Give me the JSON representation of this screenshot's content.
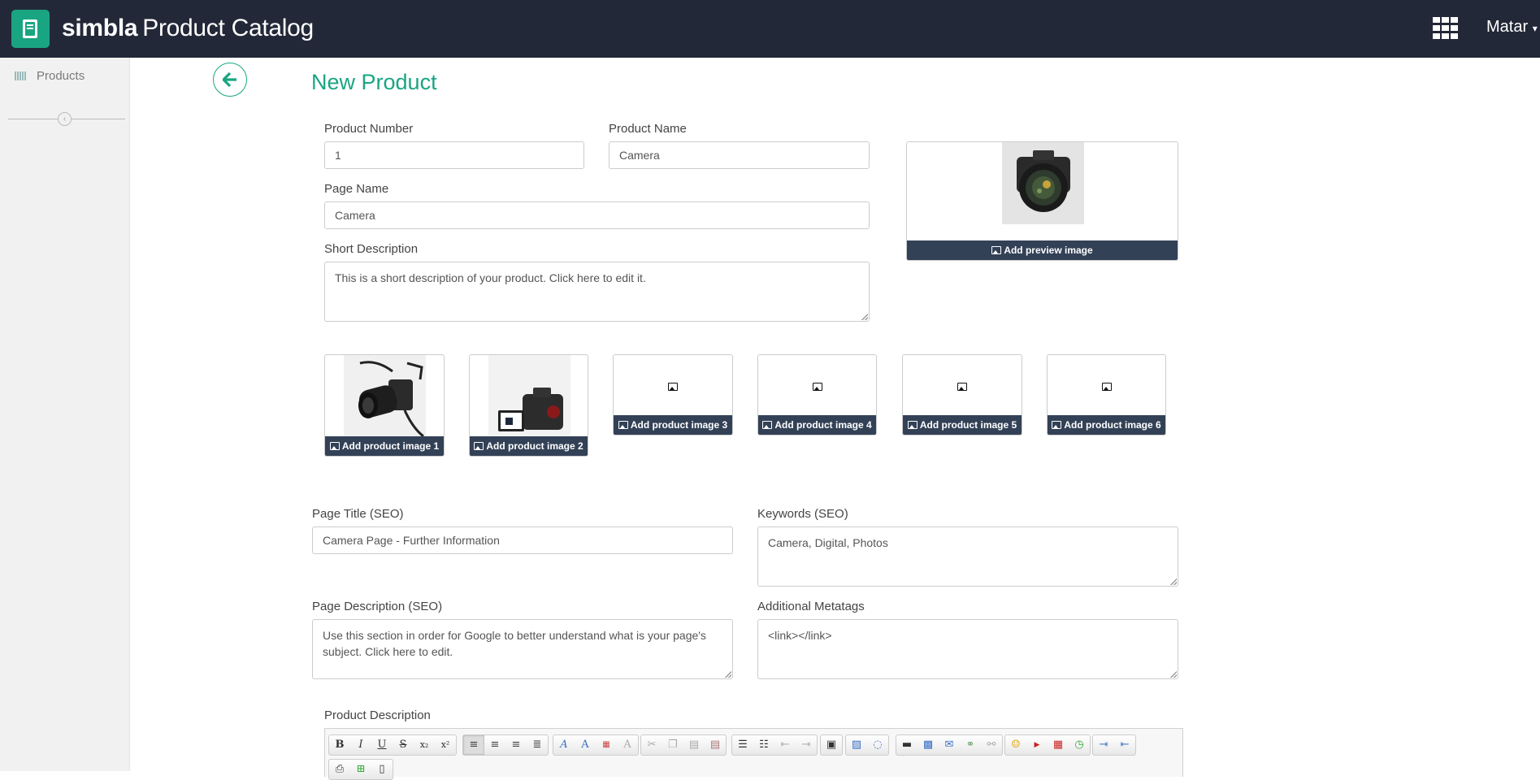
{
  "header": {
    "brand_bold": "simbla",
    "brand_light": "Product Catalog",
    "user_name": "Matar",
    "user_caret": "▾"
  },
  "sidebar": {
    "items": [
      {
        "label": "Products",
        "icon": "barcode-icon"
      }
    ],
    "collapse_glyph": "‹"
  },
  "page": {
    "title": "New Product"
  },
  "form": {
    "product_number": {
      "label": "Product Number",
      "value": "1"
    },
    "product_name": {
      "label": "Product Name",
      "value": "Camera"
    },
    "page_name": {
      "label": "Page Name",
      "value": "Camera"
    },
    "short_description": {
      "label": "Short Description",
      "value": "This is a short description of your product. Click here to edit it."
    },
    "preview_image": {
      "label": "Add preview image"
    },
    "product_images": [
      {
        "label": "Add product image 1"
      },
      {
        "label": "Add product image 2"
      },
      {
        "label": "Add product image 3"
      },
      {
        "label": "Add product image 4"
      },
      {
        "label": "Add product image 5"
      },
      {
        "label": "Add product image 6"
      }
    ],
    "page_title_seo": {
      "label": "Page Title (SEO)",
      "value": "Camera Page - Further Information"
    },
    "keywords_seo": {
      "label": "Keywords (SEO)",
      "value": "Camera, Digital, Photos"
    },
    "page_description_seo": {
      "label": "Page Description (SEO)",
      "value": "Use this section in order for Google to better understand what is your page's subject. Click here to edit."
    },
    "additional_metatags": {
      "label": "Additional Metatags",
      "value": "<link></link>"
    },
    "product_description": {
      "label": "Product Description"
    }
  },
  "editor_toolbar": {
    "bold": "B",
    "italic": "I",
    "underline": "U",
    "strike": "S",
    "subscript": "x₂",
    "superscript": "x²"
  },
  "colors": {
    "accent": "#1aa582",
    "topbar": "#232838",
    "image_bar": "#334157"
  }
}
